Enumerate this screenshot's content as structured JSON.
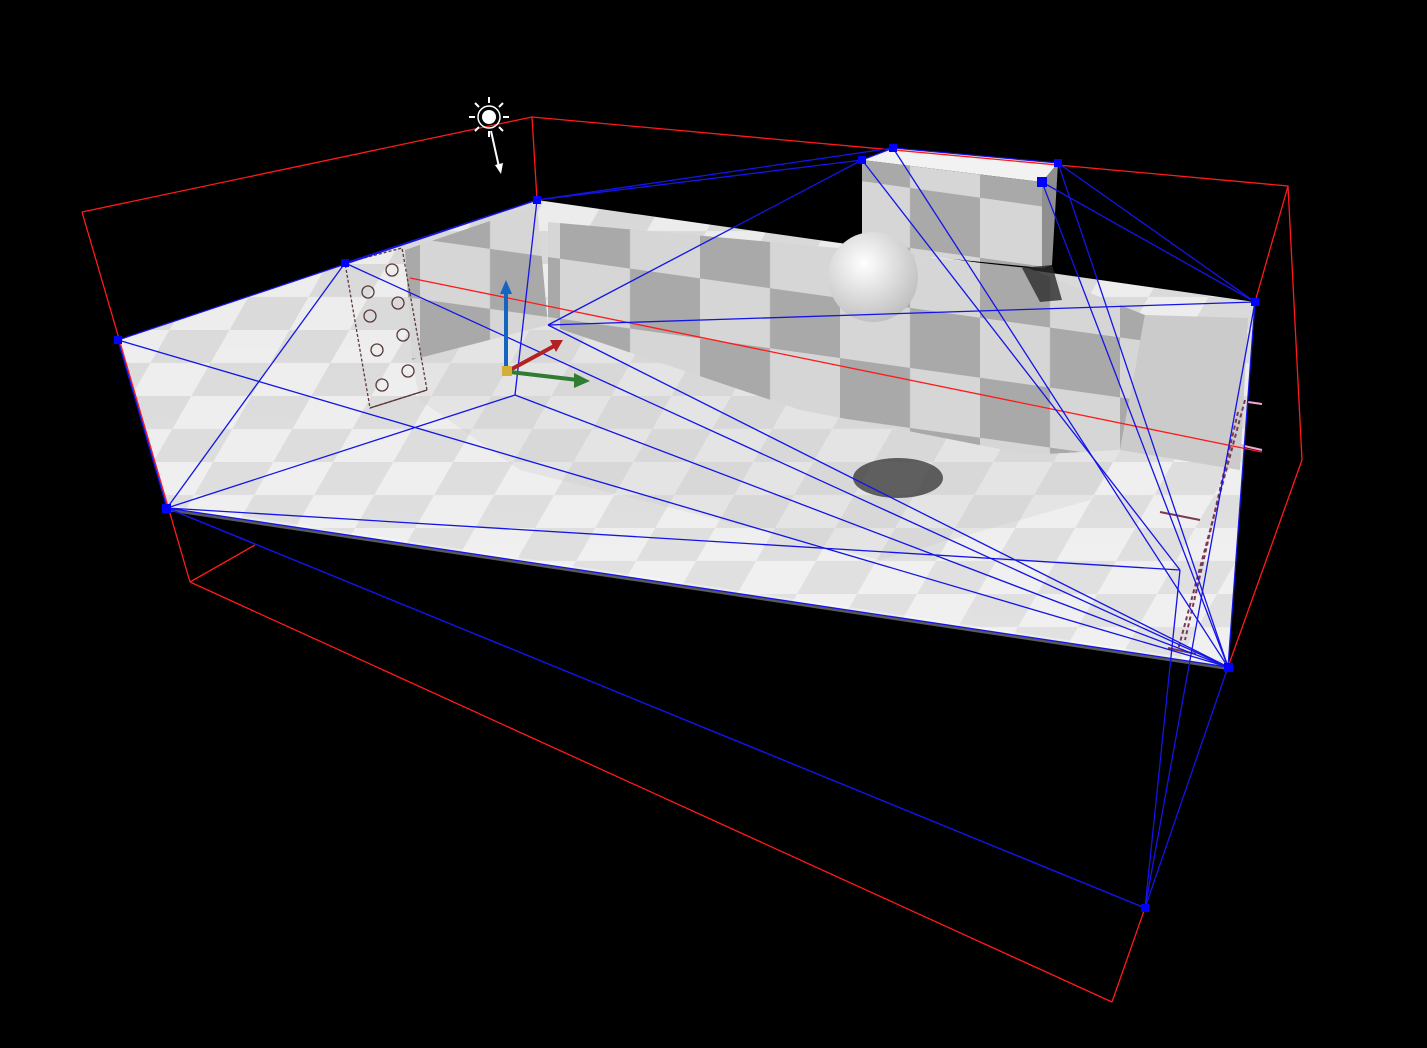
{
  "viewport": {
    "background": "#000000",
    "level_geometry": {
      "floor_color": "#e9e9e9",
      "tile_dark": "#b8b8b8",
      "wall_color": "#cfcfcf"
    },
    "bounds_box": {
      "color": "#ff1a1a"
    },
    "volume_wireframe": {
      "color": "#1414e6",
      "vertex_color": "#0000ff"
    },
    "gizmo": {
      "x_axis_color": "#b22222",
      "y_axis_color": "#2e7d32",
      "z_axis_color": "#1565c0"
    },
    "light": {
      "icon": "sun-icon",
      "color": "#ffffff"
    },
    "decals": [
      {
        "icon": "ladder-decal-icon"
      },
      {
        "icon": "ladder-decal-icon"
      }
    ]
  }
}
